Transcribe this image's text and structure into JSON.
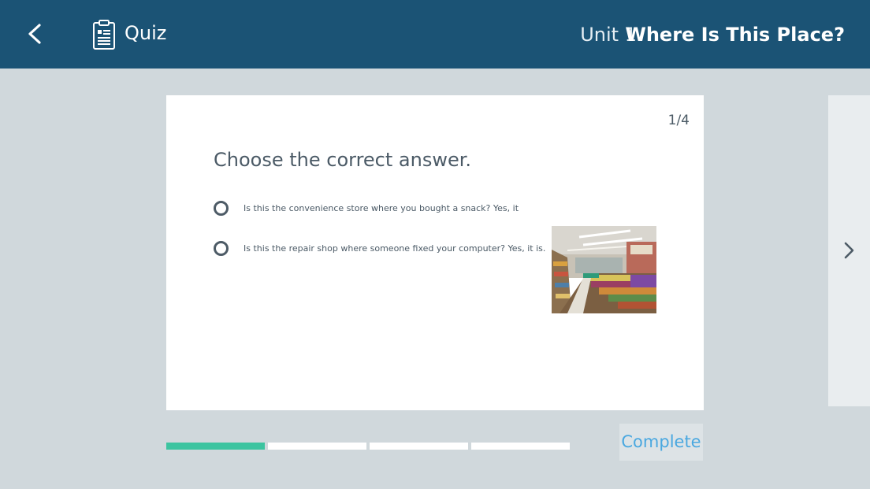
{
  "header": {
    "back_icon": "chevron-left-icon",
    "quiz_icon": "clipboard-icon",
    "section_label": "Quiz",
    "unit": "Unit 1",
    "lesson_title": "Where Is This Place?"
  },
  "quiz": {
    "counter": "1/4",
    "question": "Choose the correct answer.",
    "options": [
      {
        "text": "Is this the convenience store where you bought a snack? Yes, it",
        "selected": false
      },
      {
        "text": "Is this the repair shop where someone fixed your computer? Yes, it is.",
        "selected": false
      }
    ],
    "image_subject": "convenience store interior with snack shelves"
  },
  "navigation": {
    "next_icon": "chevron-right-icon"
  },
  "progress": {
    "current": 1,
    "total": 4,
    "active_color": "#3cc4a0"
  },
  "footer": {
    "complete_label": "Complete"
  },
  "colors": {
    "header_bg": "#1b5375",
    "page_bg": "#d0d8dc",
    "accent_link": "#4aa8e0"
  }
}
